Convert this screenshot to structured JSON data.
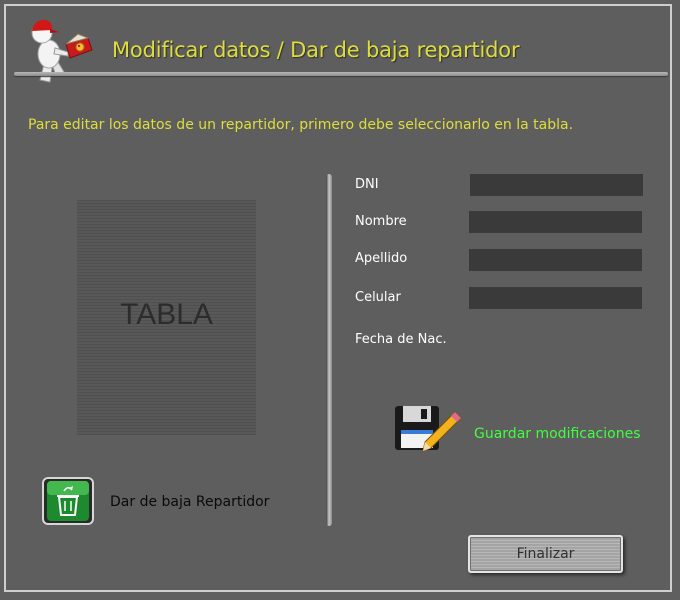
{
  "window": {
    "title": "Modificar datos / Dar de baja repartidor",
    "instructions": "Para editar los datos de un repartidor, primero debe seleccionarlo en la tabla."
  },
  "table": {
    "placeholder": "TABLA"
  },
  "form": {
    "fields": [
      {
        "label": "DNI",
        "value": ""
      },
      {
        "label": "Nombre",
        "value": ""
      },
      {
        "label": "Apellido",
        "value": ""
      },
      {
        "label": "Celular",
        "value": ""
      },
      {
        "label": "Fecha de Nac.",
        "value": ""
      }
    ]
  },
  "actions": {
    "save_label": "Guardar modificaciones",
    "delete_label": "Dar de baja Repartidor",
    "finish_label": "Finalizar"
  },
  "icons": {
    "logo": "delivery-person-icon",
    "save": "floppy-pencil-icon",
    "delete": "recycle-bin-icon"
  },
  "colors": {
    "background": "#5f5f5f",
    "title": "#dede3a",
    "save_label": "#41ff41",
    "input_bg": "#3a3a3a"
  }
}
